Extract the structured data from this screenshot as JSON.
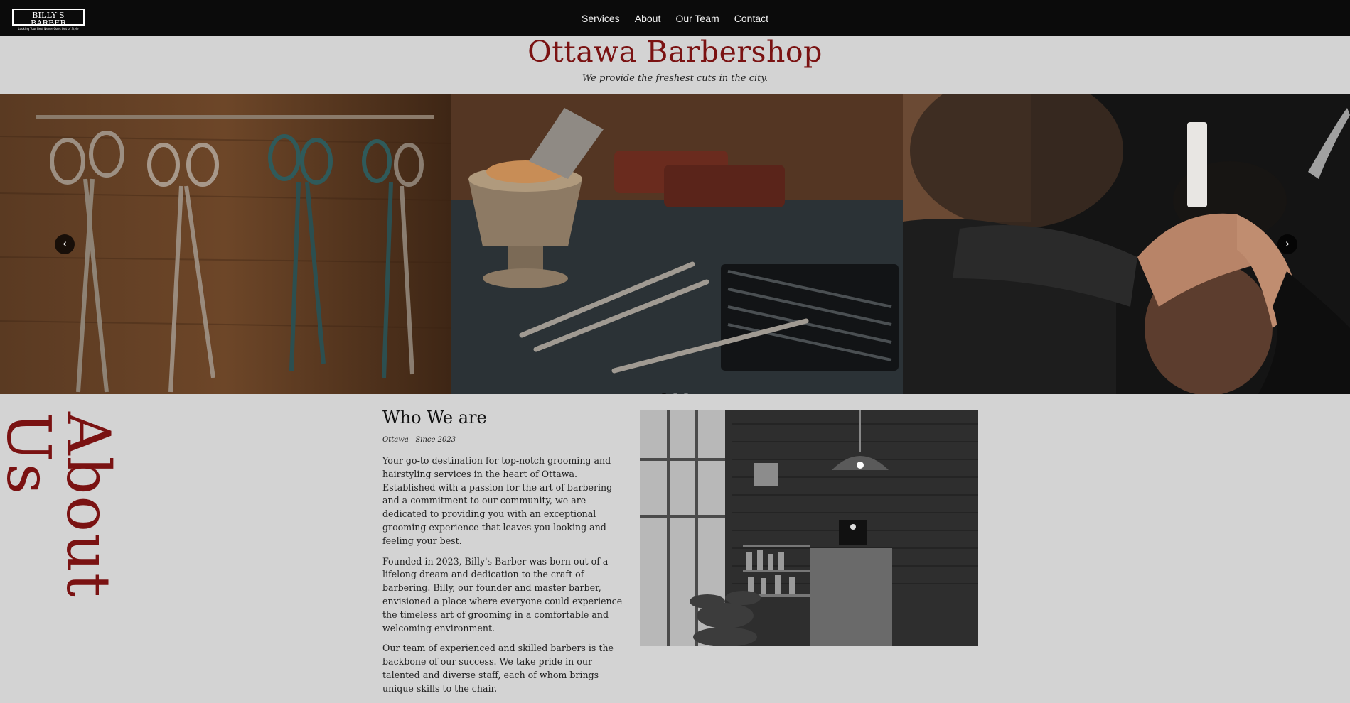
{
  "nav": {
    "logo": {
      "title": "BILLY'S BARBER",
      "tagline": "Looking Your Best Never Goes Out of Style"
    },
    "links": [
      "Services",
      "About",
      "Our Team",
      "Contact"
    ]
  },
  "hero": {
    "title": "Ottawa Barbershop",
    "tagline": "We provide the freshest cuts in the city."
  },
  "carousel": {
    "prev_icon": "chevron-left-icon",
    "next_icon": "chevron-right-icon",
    "slides": [
      "scissors-on-wall",
      "shaving-tools",
      "barber-cutting-hair"
    ],
    "active_index": 0
  },
  "about": {
    "vertical_title": "About Us",
    "heading": "Who We are",
    "subtitle": "Ottawa | Since 2023",
    "paragraphs": [
      "Your go-to destination for top-notch grooming and hairstyling services in the heart of Ottawa. Established with a passion for the art of barbering and a commitment to our community, we are dedicated to providing you with an exceptional grooming experience that leaves you looking and feeling your best.",
      "Founded in 2023, Billy's Barber was born out of a lifelong dream and dedication to the craft of barbering. Billy, our founder and master barber, envisioned a place where everyone could experience the timeless art of grooming in a comfortable and welcoming environment.",
      "Our team of experienced and skilled barbers is the backbone of our success. We take pride in our talented and diverse staff, each of whom brings unique skills to the chair."
    ]
  }
}
